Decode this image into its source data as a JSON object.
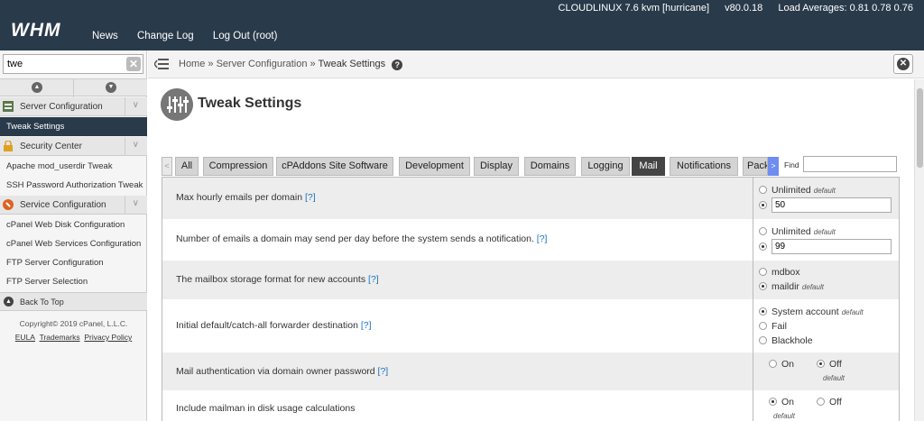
{
  "topbar": {
    "logo": "WHM",
    "nav": [
      "News",
      "Change Log",
      "Log Out (root)"
    ],
    "server": "CLOUDLINUX 7.6 kvm [hurricane]",
    "version": "v80.0.18",
    "load": "Load Averages: 0.81 0.78 0.76"
  },
  "sidebar": {
    "search_value": "twe",
    "groups": [
      {
        "label": "Server Configuration",
        "items": [
          "Tweak Settings"
        ]
      },
      {
        "label": "Security Center",
        "items": [
          "Apache mod_userdir Tweak",
          "SSH Password Authorization Tweak"
        ]
      },
      {
        "label": "Service Configuration",
        "items": [
          "cPanel Web Disk Configuration",
          "cPanel Web Services Configuration",
          "FTP Server Configuration",
          "FTP Server Selection"
        ]
      }
    ],
    "back_to_top": "Back To Top",
    "copyright": "Copyright© 2019 cPanel, L.L.C.",
    "footer_links": [
      "EULA",
      "Trademarks",
      "Privacy Policy"
    ]
  },
  "breadcrumb": {
    "home": "Home",
    "section": "Server Configuration",
    "current": "Tweak Settings",
    "sep": "»"
  },
  "page": {
    "title": "Tweak Settings"
  },
  "tabs": {
    "items": [
      "All",
      "Compression",
      "cPAddons Site Software",
      "Development",
      "Display",
      "Domains",
      "Logging",
      "Mail",
      "Notifications",
      "Pack"
    ],
    "active": "Mail",
    "prev": "<",
    "next": ">",
    "find_label": "Find"
  },
  "settings": [
    {
      "desc": "Max hourly emails per domain",
      "help": "[?]",
      "opts": [
        {
          "label": "Unlimited",
          "default": "default",
          "checked": false
        },
        {
          "value": "50",
          "checked": true
        }
      ]
    },
    {
      "desc": "Number of emails a domain may send per day before the system sends a notification.",
      "help": "[?]",
      "opts": [
        {
          "label": "Unlimited",
          "default": "default",
          "checked": false
        },
        {
          "value": "99",
          "checked": true
        }
      ]
    },
    {
      "desc": "The mailbox storage format for new accounts",
      "help": "[?]",
      "opts": [
        {
          "label": "mdbox",
          "checked": false
        },
        {
          "label": "maildir",
          "default": "default",
          "checked": true
        }
      ]
    },
    {
      "desc": "Initial default/catch-all forwarder destination",
      "help": "[?]",
      "opts": [
        {
          "label": "System account",
          "default": "default",
          "checked": true
        },
        {
          "label": "Fail",
          "checked": false
        },
        {
          "label": "Blackhole",
          "checked": false
        }
      ]
    },
    {
      "desc": "Mail authentication via domain owner password",
      "help": "[?]",
      "opts": [
        {
          "label": "On",
          "checked": false
        },
        {
          "label": "Off",
          "default": "default",
          "checked": true
        }
      ]
    },
    {
      "desc": "Include mailman in disk usage calculations",
      "help": "",
      "opts": [
        {
          "label": "On",
          "default": "default",
          "checked": true
        },
        {
          "label": "Off",
          "checked": false
        }
      ]
    }
  ]
}
